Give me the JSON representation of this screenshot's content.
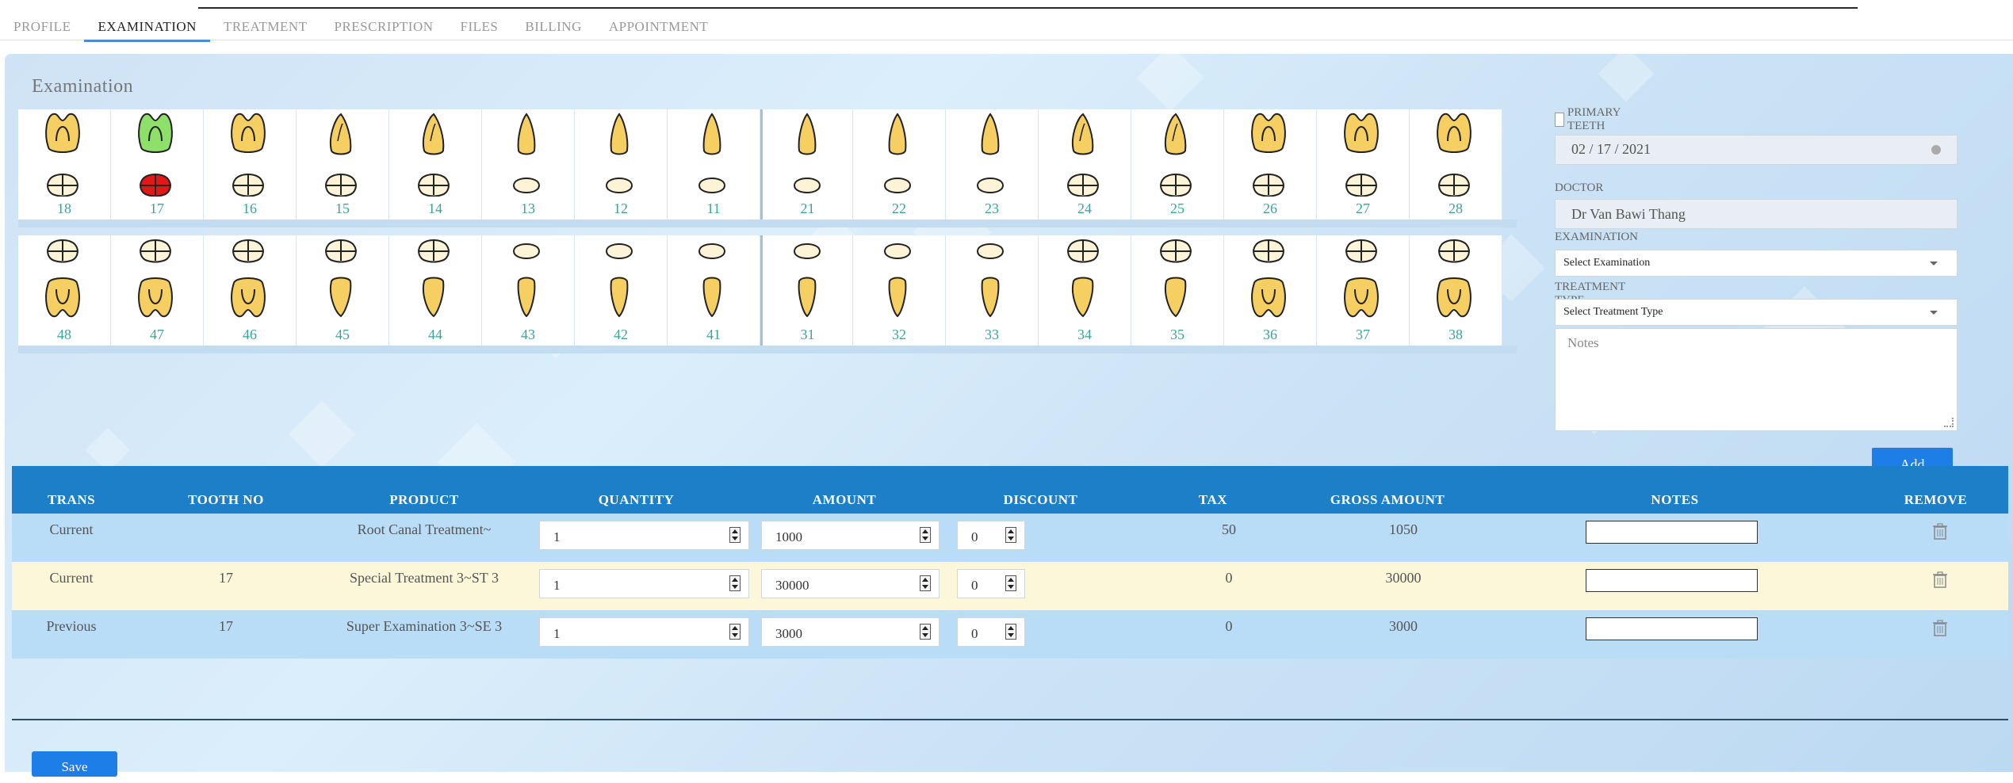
{
  "tabs": [
    "PROFILE",
    "EXAMINATION",
    "TREATMENT",
    "PRESCRIPTION",
    "FILES",
    "BILLING",
    "APPOINTMENT"
  ],
  "active_tab": "EXAMINATION",
  "section_title": "Examination",
  "upper_teeth": [
    "18",
    "17",
    "16",
    "15",
    "14",
    "13",
    "12",
    "11",
    "21",
    "22",
    "23",
    "24",
    "25",
    "26",
    "27",
    "28"
  ],
  "lower_teeth": [
    "48",
    "47",
    "46",
    "45",
    "44",
    "43",
    "42",
    "41",
    "31",
    "32",
    "33",
    "34",
    "35",
    "36",
    "37",
    "38"
  ],
  "tooth_colors": {
    "normal": "#f6cf63",
    "selected_crown": "#8fe06a",
    "marked_surface": "#e01818",
    "surface": "#fdf3d7"
  },
  "form": {
    "primary_teeth_label": "PRIMARY TEETH",
    "date": "02 / 17 / 2021",
    "doctor_label": "DOCTOR",
    "doctor": "Dr Van Bawi Thang",
    "examination_label": "EXAMINATION",
    "examination_placeholder": "Select Examination",
    "treatment_type_label": "TREATMENT TYPE",
    "treatment_type_placeholder": "Select Treatment Type",
    "notes_placeholder": "Notes",
    "add_label": "Add"
  },
  "table": {
    "headers": [
      "TRANS",
      "TOOTH NO",
      "PRODUCT",
      "QUANTITY",
      "AMOUNT",
      "DISCOUNT",
      "TAX",
      "GROSS AMOUNT",
      "NOTES",
      "REMOVE"
    ],
    "rows": [
      {
        "trans": "Current",
        "tooth": "",
        "product": "Root Canal Treatment~",
        "quantity": "1",
        "amount": "1000",
        "discount": "0",
        "tax": "50",
        "gross": "1050"
      },
      {
        "trans": "Current",
        "tooth": "17",
        "product": "Special Treatment 3~ST 3",
        "quantity": "1",
        "amount": "30000",
        "discount": "0",
        "tax": "0",
        "gross": "30000"
      },
      {
        "trans": "Previous",
        "tooth": "17",
        "product": "Super Examination 3~SE 3",
        "quantity": "1",
        "amount": "3000",
        "discount": "0",
        "tax": "0",
        "gross": "3000"
      }
    ]
  },
  "save_label": "Save"
}
